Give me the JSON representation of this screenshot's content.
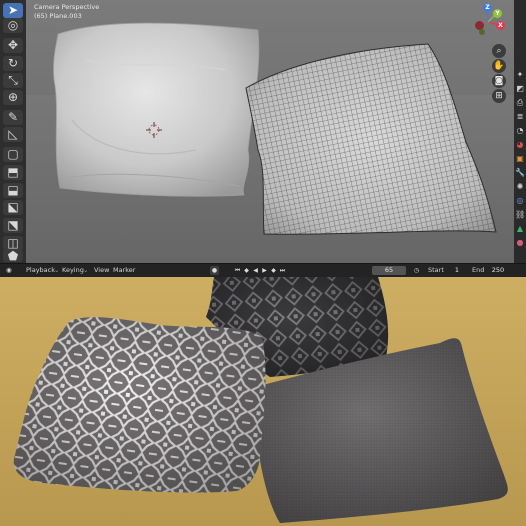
{
  "viewport": {
    "camera_label": "Camera Perspective",
    "object_label": "(65) Plane.003"
  },
  "toolbar": {
    "tools": [
      {
        "name": "select-tool-icon",
        "glyph": "➤"
      },
      {
        "name": "cursor-tool-icon",
        "glyph": "◎"
      },
      {
        "name": "move-tool-icon",
        "glyph": "✥"
      },
      {
        "name": "rotate-tool-icon",
        "glyph": "↻"
      },
      {
        "name": "scale-tool-icon",
        "glyph": "⤡"
      },
      {
        "name": "transform-tool-icon",
        "glyph": "⊕"
      },
      {
        "name": "annotate-tool-icon",
        "glyph": "✎"
      },
      {
        "name": "measure-tool-icon",
        "glyph": "◺"
      },
      {
        "name": "add-cube-tool-icon",
        "glyph": "▢"
      },
      {
        "name": "extrude-tool-icon",
        "glyph": "⬒"
      },
      {
        "name": "inset-tool-icon",
        "glyph": "⬓"
      },
      {
        "name": "bevel-tool-icon",
        "glyph": "⬕"
      },
      {
        "name": "loop-cut-tool-icon",
        "glyph": "⬔"
      },
      {
        "name": "knife-tool-icon",
        "glyph": "◫"
      },
      {
        "name": "poly-build-tool-icon",
        "glyph": "⬟"
      }
    ]
  },
  "gizmo": {
    "z_label": "Z",
    "y_label": "Y",
    "x_label": "X"
  },
  "properties_icons": [
    "tool-icon",
    "render-icon",
    "output-icon",
    "view-layer-icon",
    "scene-icon",
    "world-icon",
    "object-icon",
    "modifier-icon",
    "particles-icon",
    "physics-icon",
    "constraints-icon",
    "data-icon",
    "material-icon"
  ],
  "timeline": {
    "menu_icon": "◉",
    "playback_label": "Playback",
    "keying_label": "Keying",
    "view_label": "View",
    "marker_label": "Marker",
    "current_frame": "65",
    "start_label": "Start",
    "start_value": "1",
    "end_label": "End",
    "end_value": "250"
  },
  "colors": {
    "accent": "#4772b3",
    "axis_x": "#e3394f",
    "axis_y": "#8cc63f",
    "axis_z": "#3f7de0",
    "floor": "#c9a95f"
  }
}
